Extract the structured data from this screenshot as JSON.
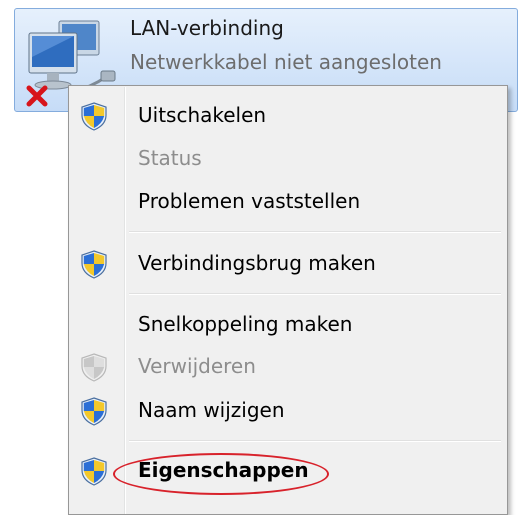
{
  "connection": {
    "name": "LAN-verbinding",
    "status": "Netwerkkabel niet aangesloten",
    "icon": "network-computer-icon",
    "error_icon": "red-x-icon"
  },
  "menu": {
    "items": [
      {
        "label": "Uitschakelen",
        "icon": "uac-shield-icon",
        "enabled": true
      },
      {
        "label": "Status",
        "icon": null,
        "enabled": false
      },
      {
        "label": "Problemen vaststellen",
        "icon": null,
        "enabled": true
      },
      {
        "label": "Verbindingsbrug maken",
        "icon": "uac-shield-icon",
        "enabled": true
      },
      {
        "label": "Snelkoppeling maken",
        "icon": null,
        "enabled": true
      },
      {
        "label": "Verwijderen",
        "icon": "uac-shield-icon",
        "enabled": false
      },
      {
        "label": "Naam wijzigen",
        "icon": "uac-shield-icon",
        "enabled": true
      },
      {
        "label": "Eigenschappen",
        "icon": "uac-shield-icon",
        "enabled": true,
        "bold": true,
        "highlighted": true
      }
    ]
  },
  "colors": {
    "highlight_circle": "#d8222b",
    "selection_border": "#84acdd",
    "shield_blue": "#2b6fd6",
    "shield_yellow": "#f3c82b"
  }
}
